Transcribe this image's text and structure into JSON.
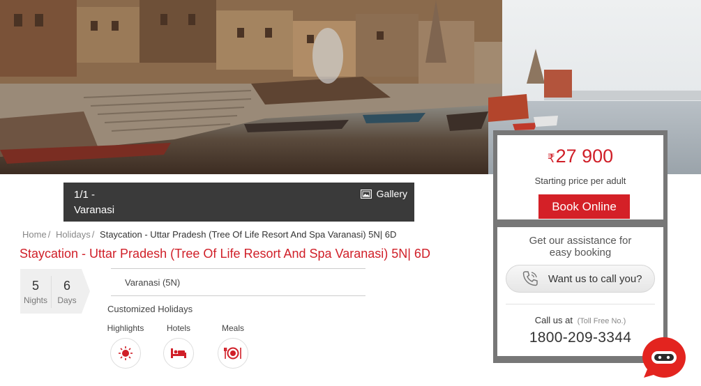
{
  "hero": {
    "image": "varanasi-ghats-photo"
  },
  "gallery_bar": {
    "counter": "1/1  -",
    "place": "Varanasi",
    "gallery_label": "Gallery",
    "gallery_icon": "image-icon"
  },
  "breadcrumb": {
    "home": "Home",
    "holidays": "Holidays",
    "current": "Staycation - Uttar Pradesh (Tree Of Life Resort And Spa Varanasi) 5N| 6D"
  },
  "package": {
    "title": "Staycation - Uttar Pradesh (Tree Of Life Resort And Spa Varanasi) 5N| 6D",
    "nights": "5",
    "nights_label": "Nights",
    "days": "6",
    "days_label": "Days",
    "destination": "Varanasi (5N)",
    "holiday_type": "Customized Holidays",
    "features": [
      {
        "label": "Highlights",
        "icon": "sun-icon"
      },
      {
        "label": "Hotels",
        "icon": "bed-icon"
      },
      {
        "label": "Meals",
        "icon": "meal-icon"
      }
    ]
  },
  "booking": {
    "currency_symbol": "₹",
    "price": "27 900",
    "price_sub": "Starting price per adult",
    "book_label": "Book Online",
    "assist_title_line1": "Get our assistance for",
    "assist_title_line2": "easy booking",
    "call_button_label": "Want us to call you?",
    "call_us_label": "Call us at",
    "toll_free_label": "(Toll Free No.)",
    "phone": "1800-209-3344"
  },
  "colors": {
    "brand_red": "#d01f28",
    "panel_border": "#777777",
    "caption_bg": "#3a3a3a"
  }
}
